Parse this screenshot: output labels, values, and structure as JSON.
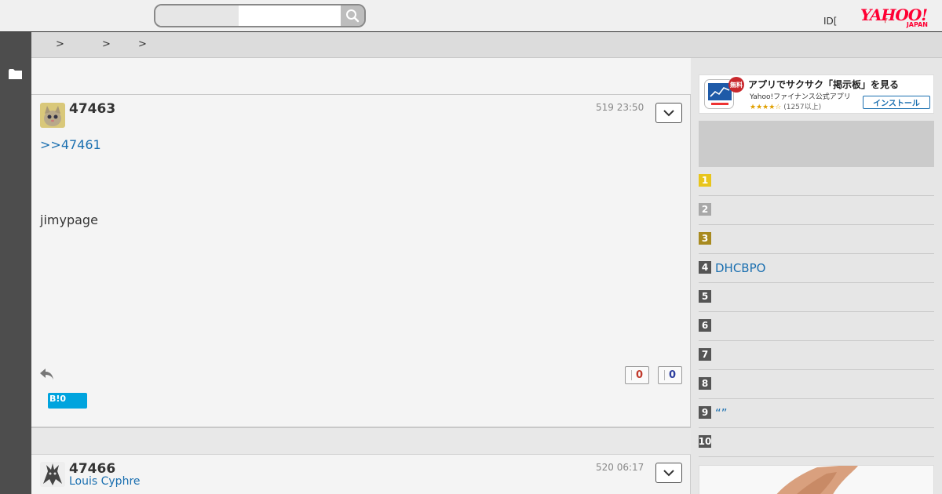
{
  "header": {
    "search_placeholder": "",
    "id_link": "ID[",
    "small_mark": "┼",
    "logo_text": "YAHOO!",
    "logo_sub": "JAPAN"
  },
  "breadcrumb": [
    ">",
    ">",
    ">"
  ],
  "posts": [
    {
      "number": "47463",
      "date": "519 23:50",
      "anchor": ">>47461",
      "body": "jimypage",
      "votes_up": "0",
      "votes_down": "0",
      "hatena": "B!0"
    },
    {
      "number": "47466",
      "user": "Louis Cyphre",
      "date": "520 06:17"
    }
  ],
  "ad": {
    "badge": "無料",
    "title": "アプリでサクサク「掲示板」を見る",
    "subtitle": "Yahoo!ファイナンス公式アプリ",
    "stars": "★★★★☆",
    "rating": "(1257以上)",
    "install_label": "インストール"
  },
  "ranking": [
    {
      "rank": "1",
      "label": "",
      "color": "#e8c51c"
    },
    {
      "rank": "2",
      "label": "",
      "color": "#a8a8a8"
    },
    {
      "rank": "3",
      "label": "",
      "color": "#a88a20"
    },
    {
      "rank": "4",
      "label": "DHCBPO",
      "color": "#555555"
    },
    {
      "rank": "5",
      "label": "",
      "color": "#555555"
    },
    {
      "rank": "6",
      "label": "",
      "color": "#555555"
    },
    {
      "rank": "7",
      "label": "",
      "color": "#555555"
    },
    {
      "rank": "8",
      "label": "",
      "color": "#555555"
    },
    {
      "rank": "9",
      "label": "“”",
      "color": "#555555"
    },
    {
      "rank": "10",
      "label": "",
      "color": "#555555"
    }
  ],
  "colors": {
    "accent": "#1a6fb0",
    "vote_up": "#c0392b",
    "vote_down": "#2c3e9e",
    "rail": "#4d4d4d"
  }
}
